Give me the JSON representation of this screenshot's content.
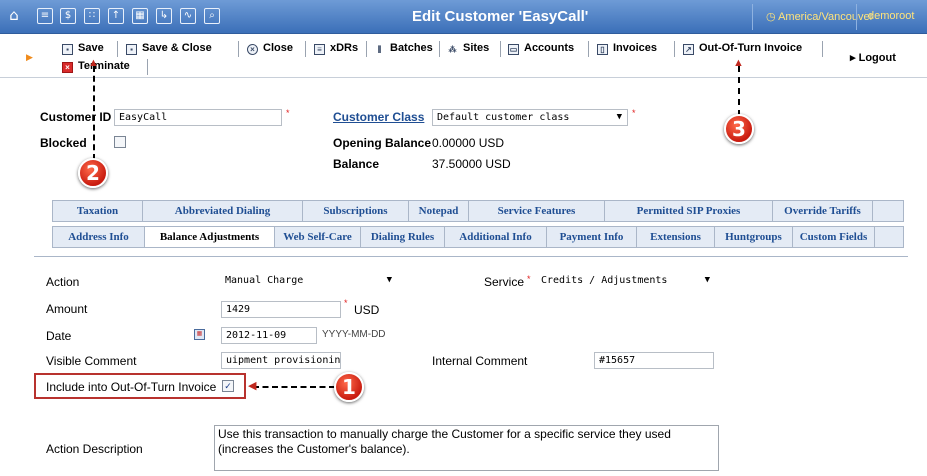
{
  "topbar": {
    "title": "Edit Customer 'EasyCall'",
    "timezone": "America/Vancouver",
    "user": "demoroot",
    "icons": [
      "home-icon",
      "list-icon",
      "dollar-icon",
      "grid-icon",
      "upload-icon",
      "tariff-icon",
      "route-icon",
      "chart-icon",
      "search-icon"
    ]
  },
  "toolbar": {
    "save": "Save",
    "save_close": "Save & Close",
    "close": "Close",
    "xdrs": "xDRs",
    "batches": "Batches",
    "sites": "Sites",
    "accounts": "Accounts",
    "invoices": "Invoices",
    "oot_invoice": "Out-Of-Turn Invoice",
    "terminate": "Terminate",
    "logout": "Logout"
  },
  "customer": {
    "id_label": "Customer ID",
    "id_value": "EasyCall",
    "blocked_label": "Blocked",
    "class_label": "Customer Class",
    "class_value": "Default customer class",
    "opening_label": "Opening Balance",
    "opening_value": "0.00000 USD",
    "balance_label": "Balance",
    "balance_value": "37.50000 USD"
  },
  "tabs_row1": [
    "Taxation",
    "Abbreviated Dialing",
    "Subscriptions",
    "Notepad",
    "Service Features",
    "Permitted SIP Proxies",
    "Override Tariffs"
  ],
  "tabs_row2": [
    "Address Info",
    "Balance Adjustments",
    "Web Self-Care",
    "Dialing Rules",
    "Additional Info",
    "Payment Info",
    "Extensions",
    "Huntgroups",
    "Custom Fields"
  ],
  "form": {
    "action_label": "Action",
    "action_value": "Manual Charge",
    "service_label": "Service",
    "service_value": "Credits / Adjustments",
    "amount_label": "Amount",
    "amount_value": "1429",
    "amount_unit": "USD",
    "date_label": "Date",
    "date_value": "2012-11-09",
    "date_hint": "YYYY-MM-DD",
    "visible_comment_label": "Visible Comment",
    "visible_comment_value": "uipment provisioning",
    "internal_comment_label": "Internal Comment",
    "internal_comment_value": "#15657",
    "oot_label": "Include into Out-Of-Turn Invoice",
    "oot_checked": true,
    "desc_label": "Action Description",
    "desc_text": "Use this transaction to manually charge the Customer for a specific service they used (increases the Customer's balance)."
  },
  "callouts": [
    "1",
    "2",
    "3"
  ],
  "colors": {
    "header": "#3b6fb8",
    "accent": "#c91c10",
    "tab_text": "#1f4e93"
  }
}
